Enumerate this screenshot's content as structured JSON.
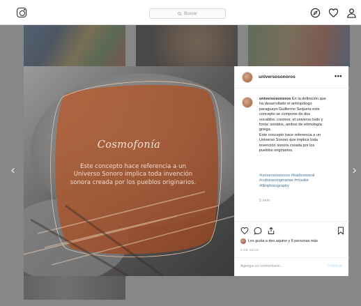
{
  "search": {
    "placeholder": "Buscar"
  },
  "post": {
    "username": "universosonoros",
    "more_label": "•••",
    "art_title": "Cosmofonía",
    "art_text": "Este concepto hace referencia a un Universo Sonoro implica toda invención sonora creada por los pueblos originarios.",
    "caption_user": "universosonoros",
    "caption_lines": [
      "En la definición que",
      "ha desarrollado el antropólogo",
      "paraguayo Guillermo Sequera este",
      "concepto se compone de dos",
      "vocablos: cosmos: el universo todo y",
      "fonía: sonidos, ambos de etimología",
      "griega.",
      "Este concepto hace referencia a un",
      "Universo Sonoro que implica toda",
      "invención sonora creada por los",
      "pueblos originarios."
    ],
    "hashtags": [
      "#universosonoros #tradicionoral",
      "#culturasoriginarias #musiké",
      "#filmphotography"
    ],
    "time_ago": "5 sem",
    "likes": "Les gusta a deo.aquino y 8 personas más",
    "date": "4 DE JULIO",
    "comment_placeholder": "Agrega un comentario...",
    "publish_label": "Publicar"
  },
  "nav": {
    "prev_arrow": "‹",
    "next_arrow": "›"
  },
  "colors": {
    "accent_link": "#3f729b",
    "publish_disabled": "#b2dffc",
    "card": "#a8552d"
  },
  "icons": [
    "instagram-logo-icon",
    "search-icon",
    "compass-icon",
    "heart-icon",
    "profile-icon",
    "more-icon",
    "like-icon",
    "comment-icon",
    "share-icon",
    "bookmark-icon"
  ]
}
